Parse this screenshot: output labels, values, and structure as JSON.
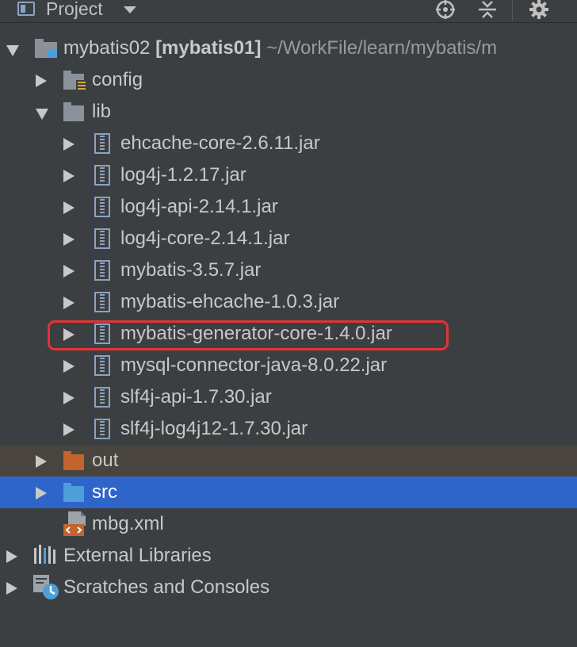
{
  "toolbar": {
    "title": "Project"
  },
  "tree": {
    "root": {
      "name": "mybatis02",
      "module": "[mybatis01]",
      "path": "~/WorkFile/learn/mybatis/m"
    },
    "config": "config",
    "lib": "lib",
    "jars": [
      "ehcache-core-2.6.11.jar",
      "log4j-1.2.17.jar",
      "log4j-api-2.14.1.jar",
      "log4j-core-2.14.1.jar",
      "mybatis-3.5.7.jar",
      "mybatis-ehcache-1.0.3.jar",
      "mybatis-generator-core-1.4.0.jar",
      "mysql-connector-java-8.0.22.jar",
      "slf4j-api-1.7.30.jar",
      "slf4j-log4j12-1.7.30.jar"
    ],
    "out": "out",
    "src": "src",
    "mbg": "mbg.xml",
    "external": "External Libraries",
    "scratches": "Scratches and Consoles"
  },
  "colors": {
    "selection": "#2f65ca",
    "excluded": "#49453e",
    "highlight": "#e33434",
    "out_folder": "#c3632d",
    "src_folder": "#4d9ed9"
  }
}
